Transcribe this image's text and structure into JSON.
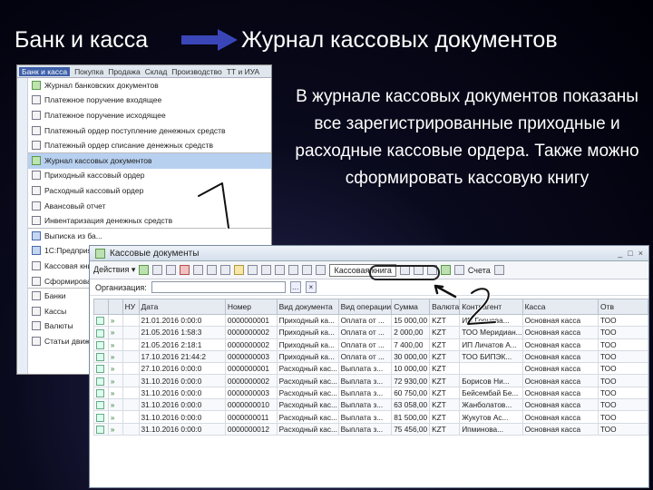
{
  "breadcrumb": {
    "from": "Банк и касса",
    "to": "Журнал кассовых документов"
  },
  "menu": {
    "bar": [
      "Банк и касса",
      "Покупка",
      "Продажа",
      "Склад",
      "Производство",
      "ТТ и ИУА"
    ],
    "items": [
      {
        "label": "Журнал банковских документов",
        "icon": "green",
        "sep": false,
        "sel": false
      },
      {
        "label": "Платежное поручение входящее",
        "icon": "plain",
        "sep": false,
        "sel": false
      },
      {
        "label": "Платежное поручение исходящее",
        "icon": "plain",
        "sep": false,
        "sel": false
      },
      {
        "label": "Платежный ордер поступление денежных средств",
        "icon": "plain",
        "sep": false,
        "sel": false
      },
      {
        "label": "Платежный ордер списание денежных средств",
        "icon": "plain",
        "sep": true,
        "sel": false
      },
      {
        "label": "Журнал кассовых документов",
        "icon": "green",
        "sep": false,
        "sel": true
      },
      {
        "label": "Приходный кассовый ордер",
        "icon": "plain",
        "sep": false,
        "sel": false
      },
      {
        "label": "Расходный кассовый ордер",
        "icon": "plain",
        "sep": false,
        "sel": false
      },
      {
        "label": "Авансовый отчет",
        "icon": "plain",
        "sep": false,
        "sel": false
      },
      {
        "label": "Инвентаризация денежных средств",
        "icon": "plain",
        "sep": true,
        "sel": false
      },
      {
        "label": "Выписка из ба...",
        "icon": "blue",
        "sep": false,
        "sel": false
      },
      {
        "label": "1С:Предприят...",
        "icon": "blue",
        "sep": false,
        "sel": false
      },
      {
        "label": "Кассовая кни...",
        "icon": "plain",
        "sep": false,
        "sel": false
      },
      {
        "label": "Сформирова...",
        "icon": "plain",
        "sep": true,
        "sel": false
      },
      {
        "label": "Банки",
        "icon": "plain",
        "sep": false,
        "sel": false
      },
      {
        "label": "Кассы",
        "icon": "plain",
        "sep": false,
        "sel": false
      },
      {
        "label": "Валюты",
        "icon": "plain",
        "sep": false,
        "sel": false
      },
      {
        "label": "Статьи движ...",
        "icon": "plain",
        "sep": false,
        "sel": false
      }
    ]
  },
  "description": "В журнале кассовых документов показаны все зарегистрированные приходные и расходные кассовые ордера. Также можно сформировать кассовую книгу",
  "annotations": {
    "one": "1",
    "two": "2"
  },
  "journal": {
    "title": "Кассовые документы",
    "window_controls": [
      "_",
      "□",
      "×"
    ],
    "toolbar": {
      "actions": "Действия ▾",
      "report": "Кассовая книга",
      "accounts": "Счета"
    },
    "filter_label": "Организация:",
    "filter_value": "",
    "columns": [
      "",
      "",
      "НУ",
      "Дата",
      "Номер",
      "Вид документа",
      "Вид операции",
      "Сумма",
      "Валюта",
      "Контрагент",
      "Касса",
      "Отв"
    ],
    "rows": [
      [
        "",
        "",
        "",
        "21.01.2016 0:00:0",
        "0000000001",
        "Приходный ка...",
        "Оплата от ...",
        "15 000,00",
        "KZT",
        "ИП Горнова...",
        "Основная касса",
        "ТОО"
      ],
      [
        "",
        "",
        "",
        "21.05.2016 1:58:3",
        "0000000002",
        "Приходный ка...",
        "Оплата от ...",
        "2 000,00",
        "KZT",
        "ТОО Меридиан...",
        "Основная касса",
        "ТОО"
      ],
      [
        "",
        "",
        "",
        "21.05.2016 2:18:1",
        "0000000002",
        "Приходный ка...",
        "Оплата от ...",
        "7 400,00",
        "KZT",
        "ИП Личатов А...",
        "Основная касса",
        "ТОО"
      ],
      [
        "",
        "",
        "",
        "17.10.2016 21:44:2",
        "0000000003",
        "Приходный ка...",
        "Оплата от ...",
        "30 000,00",
        "KZT",
        "ТОО БИПЭК...",
        "Основная касса",
        "ТОО"
      ],
      [
        "",
        "",
        "",
        "27.10.2016 0:00:0",
        "0000000001",
        "Расходный кас...",
        "Выплата з...",
        "10 000,00",
        "KZT",
        "",
        "Основная касса",
        "ТОО"
      ],
      [
        "",
        "",
        "",
        "31.10.2016 0:00:0",
        "0000000002",
        "Расходный кас...",
        "Выплата з...",
        "72 930,00",
        "KZT",
        "Борисов Ни...",
        "Основная касса",
        "ТОО"
      ],
      [
        "",
        "",
        "",
        "31.10.2016 0:00:0",
        "0000000003",
        "Расходный кас...",
        "Выплата з...",
        "60 750,00",
        "KZT",
        "Бейсембай Бе...",
        "Основная касса",
        "ТОО"
      ],
      [
        "",
        "",
        "",
        "31.10.2016 0:00:0",
        "0000000010",
        "Расходный кас...",
        "Выплата з...",
        "63 058,00",
        "KZT",
        "Жанболатов...",
        "Основная касса",
        "ТОО"
      ],
      [
        "",
        "",
        "",
        "31.10.2016 0:00:0",
        "0000000011",
        "Расходный кас...",
        "Выплата з...",
        "81 500,00",
        "KZT",
        "Жукутов Ас...",
        "Основная касса",
        "ТОО"
      ],
      [
        "",
        "",
        "",
        "31.10.2016 0:00:0",
        "0000000012",
        "Расходный кас...",
        "Выплата з...",
        "75 456,00",
        "KZT",
        "Ипминова...",
        "Основная касса",
        "ТОО"
      ]
    ]
  }
}
